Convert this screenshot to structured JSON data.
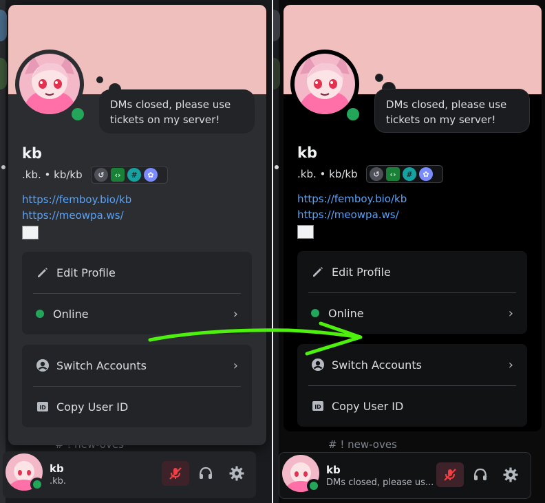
{
  "colors": {
    "banner": "#efbfbe",
    "online": "#23a55a",
    "link": "#5aa3f7",
    "annotation_arrow": "#4ef00e",
    "muted": "#f23f43"
  },
  "panels": [
    {
      "id": "before",
      "profile": {
        "custom_status": "DMs closed, please use tickets on my server!",
        "display_name": "kb",
        "username": ".kb.",
        "separator": "•",
        "pronouns": "kb/kb",
        "badges": [
          "nitro-badge-icon",
          "active-developer-badge-icon",
          "hypesquad-badge-icon",
          "boost-badge-icon"
        ],
        "links": [
          "https://femboy.bio/kb",
          "https://meowpa.ws/"
        ]
      },
      "menu": {
        "edit_profile": "Edit Profile",
        "status": "Online",
        "switch_accounts": "Switch Accounts",
        "copy_user_id": "Copy User ID"
      },
      "channel_text": "# ! new-oves",
      "user_panel": {
        "name": "kb",
        "subtext": ".kb."
      }
    },
    {
      "id": "after",
      "profile": {
        "custom_status": "DMs closed, please use tickets on my server!",
        "display_name": "kb",
        "username": ".kb.",
        "separator": "•",
        "pronouns": "kb/kb",
        "badges": [
          "nitro-badge-icon",
          "active-developer-badge-icon",
          "hypesquad-badge-icon",
          "boost-badge-icon"
        ],
        "links": [
          "https://femboy.bio/kb",
          "https://meowpa.ws/"
        ]
      },
      "menu": {
        "edit_profile": "Edit Profile",
        "status": "Online",
        "switch_accounts": "Switch Accounts",
        "copy_user_id": "Copy User ID"
      },
      "channel_text": "# ! new-oves",
      "user_panel": {
        "name": "kb",
        "subtext": "DMs closed, please us..."
      }
    }
  ]
}
